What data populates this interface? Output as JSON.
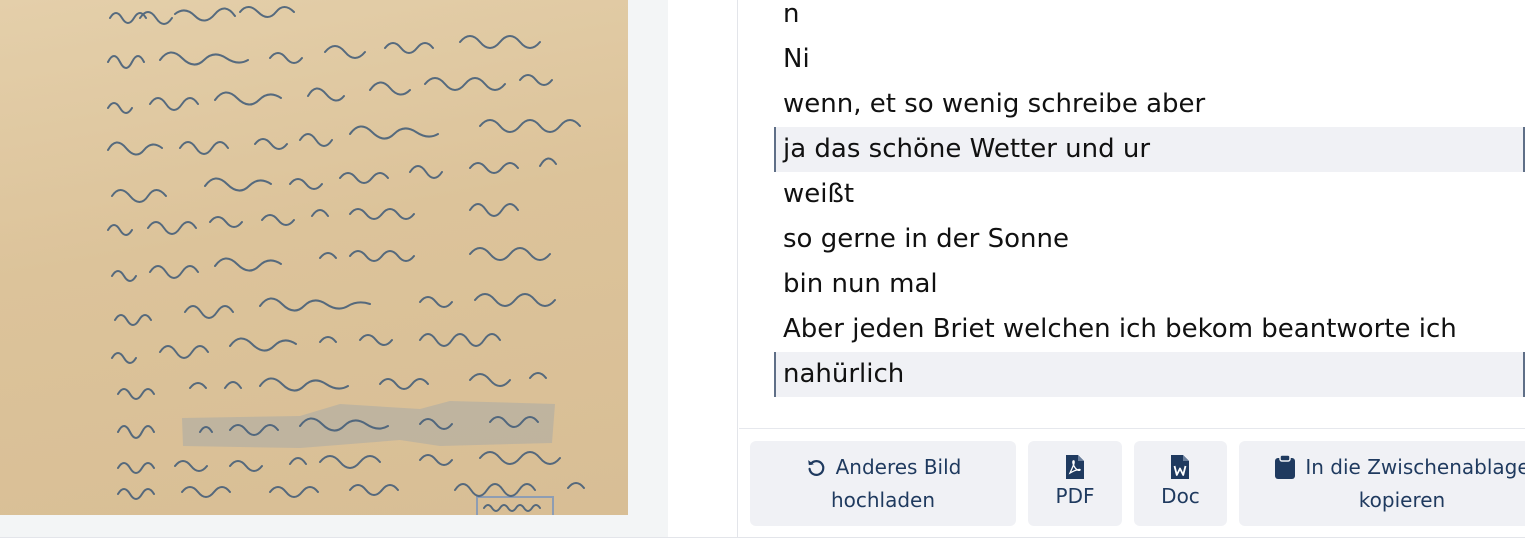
{
  "transcription": {
    "lines": [
      {
        "text": "n",
        "selected": false
      },
      {
        "text": "Ni",
        "selected": false
      },
      {
        "text": "wenn, et so wenig schreibe aber",
        "selected": false
      },
      {
        "text": "ja das schöne Wetter und ur",
        "selected": true
      },
      {
        "text": "weißt",
        "selected": false
      },
      {
        "text": "so gerne in der Sonne",
        "selected": false
      },
      {
        "text": "bin nun mal",
        "selected": false
      },
      {
        "text": "Aber jeden Briet welchen ich bekom beantworte ich",
        "selected": false
      },
      {
        "text": "nahürlich",
        "selected": true
      }
    ]
  },
  "buttons": {
    "upload": {
      "line1": "Anderes Bild",
      "line2": "hochladen",
      "icon": "refresh-icon"
    },
    "pdf": {
      "label": "PDF",
      "icon": "pdf-file-icon"
    },
    "doc": {
      "label": "Doc",
      "icon": "word-file-icon"
    },
    "clipboard": {
      "line1": "In die Zwischenablage",
      "line2": "kopieren",
      "icon": "clipboard-icon"
    }
  },
  "colors": {
    "accent": "#1f3a5f",
    "selection_bg": "#f0f1f5",
    "selection_border": "#5f6f87",
    "paper": "#dcc39a",
    "ink": "#3e5a78"
  }
}
